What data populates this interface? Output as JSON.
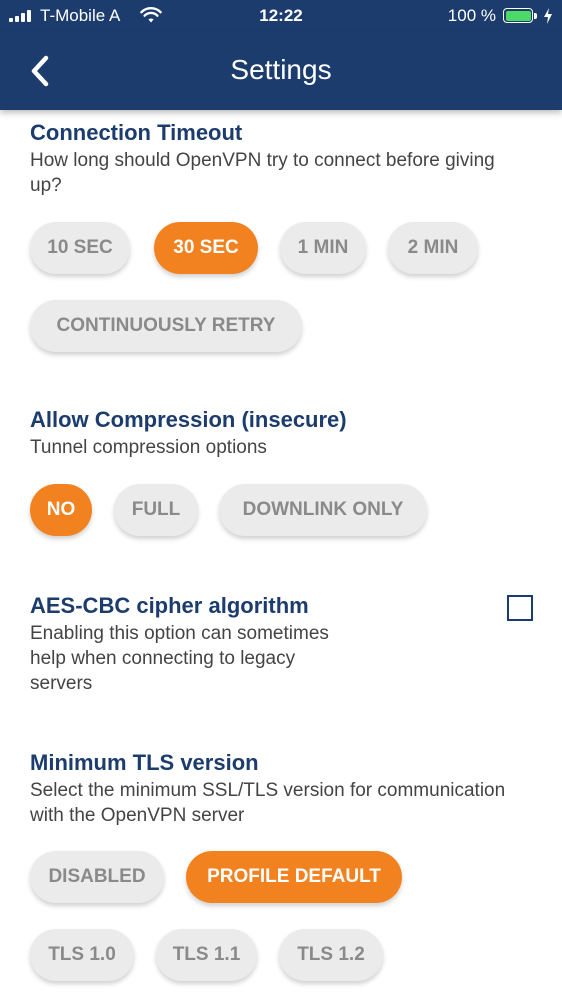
{
  "status_bar": {
    "carrier": "T-Mobile A",
    "time": "12:22",
    "battery_percent": "100 %",
    "battery_color": "#4cd964"
  },
  "nav": {
    "title": "Settings",
    "back_icon": "chevron-left-icon"
  },
  "colors": {
    "header_bg": "#1c3c6e",
    "title_color": "#1c3c6e",
    "accent": "#f2811f",
    "pill_bg": "#ebebeb",
    "pill_text": "#8a8a8a"
  },
  "connection_timeout": {
    "title": "Connection Timeout",
    "description": "How long should OpenVPN try to connect before giving up?",
    "options": [
      {
        "label": "10 SEC",
        "selected": false
      },
      {
        "label": "30 SEC",
        "selected": true
      },
      {
        "label": "1 MIN",
        "selected": false
      },
      {
        "label": "2 MIN",
        "selected": false
      },
      {
        "label": "CONTINUOUSLY RETRY",
        "selected": false
      }
    ]
  },
  "compression": {
    "title": "Allow Compression (insecure)",
    "description": "Tunnel compression options",
    "options": [
      {
        "label": "NO",
        "selected": true
      },
      {
        "label": "FULL",
        "selected": false
      },
      {
        "label": "DOWNLINK ONLY",
        "selected": false
      }
    ]
  },
  "aes_cbc": {
    "title": "AES-CBC cipher algorithm",
    "description_lines": [
      "Enabling this option can sometimes",
      "help when connecting to legacy",
      "servers"
    ],
    "checked": false
  },
  "tls": {
    "title": "Minimum TLS version",
    "description": "Select the minimum SSL/TLS version for communication with the OpenVPN server",
    "options": [
      {
        "label": "DISABLED",
        "selected": false
      },
      {
        "label": "PROFILE DEFAULT",
        "selected": true
      },
      {
        "label": "TLS 1.0",
        "selected": false
      },
      {
        "label": "TLS 1.1",
        "selected": false
      },
      {
        "label": "TLS 1.2",
        "selected": false
      }
    ]
  }
}
